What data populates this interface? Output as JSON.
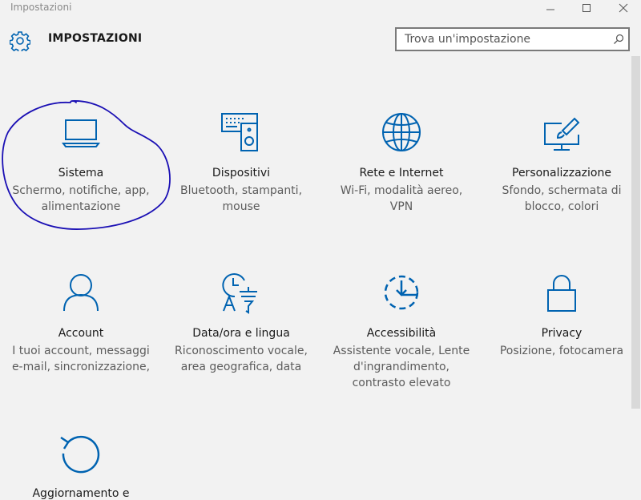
{
  "window": {
    "title": "Impostazioni",
    "controls": [
      "minimize",
      "maximize",
      "close"
    ]
  },
  "header": {
    "title": "IMPOSTAZIONI",
    "icon": "gear-icon"
  },
  "search": {
    "placeholder": "Trova un'impostazione",
    "value": "",
    "icon": "search-icon"
  },
  "colors": {
    "accent": "#0063b1",
    "background": "#f2f2f2",
    "annotation": "#1a0fb4"
  },
  "categories": [
    {
      "name": "Sistema",
      "description": "Schermo, notifiche, app, alimentazione",
      "icon": "laptop-icon"
    },
    {
      "name": "Dispositivi",
      "description": "Bluetooth, stampanti, mouse",
      "icon": "devices-icon"
    },
    {
      "name": "Rete e Internet",
      "description": "Wi-Fi, modalità aereo, VPN",
      "icon": "globe-icon"
    },
    {
      "name": "Personalizzazione",
      "description": "Sfondo, schermata di blocco, colori",
      "icon": "paint-icon"
    },
    {
      "name": "Account",
      "description": "I tuoi account, messaggi e-mail, sincronizzazione,",
      "icon": "person-icon"
    },
    {
      "name": "Data/ora e lingua",
      "description": "Riconoscimento vocale, area geografica, data",
      "icon": "time-language-icon"
    },
    {
      "name": "Accessibilità",
      "description": "Assistente vocale, Lente d'ingrandimento, contrasto elevato",
      "icon": "accessibility-icon"
    },
    {
      "name": "Privacy",
      "description": "Posizione, fotocamera",
      "icon": "lock-icon"
    },
    {
      "name": "Aggiornamento e",
      "description": "",
      "icon": "update-icon"
    }
  ]
}
